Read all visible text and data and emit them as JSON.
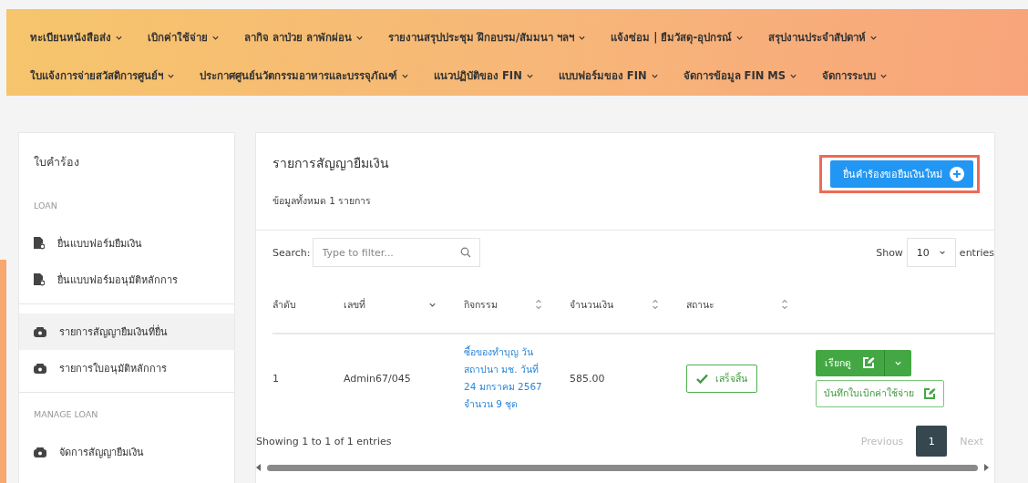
{
  "nav_rows": [
    [
      {
        "label": "ทะเบียนหนังสือส่ง"
      },
      {
        "label": "เบิกค่าใช้จ่าย"
      },
      {
        "label": "ลากิจ ลาป่วย ลาพักผ่อน"
      },
      {
        "label": "รายงานสรุปประชุม ฝึกอบรม/สัมมนา ฯลฯ"
      },
      {
        "label": "แจ้งซ่อม | ยืมวัสดุ-อุปกรณ์"
      },
      {
        "label": "สรุปงานประจำสัปดาห์"
      }
    ],
    [
      {
        "label": "ใบแจ้งการจ่ายสวัสดิการศูนย์ฯ"
      },
      {
        "label": "ประกาศศูนย์นวัตกรรมอาหารและบรรจุภัณฑ์"
      },
      {
        "label": "แนวปฏิบัติของ FIN"
      },
      {
        "label": "แบบฟอร์มของ FIN"
      },
      {
        "label": "จัดการข้อมูล FIN MS"
      },
      {
        "label": "จัดการระบบ"
      }
    ]
  ],
  "sidebar": {
    "title": "ใบคำร้อง",
    "sections": [
      {
        "heading": "LOAN",
        "items": [
          {
            "label": "ยื่นแบบฟอร์มยืมเงิน",
            "kind": "file",
            "selected": false
          },
          {
            "label": "ยื่นแบบฟอร์มอนุมัติหลักการ",
            "kind": "file",
            "selected": false
          }
        ]
      },
      {
        "items": [
          {
            "label": "รายการสัญญายืมเงินที่ยื่น",
            "kind": "cash",
            "selected": true
          },
          {
            "label": "รายการใบอนุมัติหลักการ",
            "kind": "cash",
            "selected": false
          }
        ]
      },
      {
        "heading": "MANAGE LOAN",
        "items": [
          {
            "label": "จัดการสัญญายืมเงิน",
            "kind": "cash",
            "selected": false
          }
        ]
      }
    ]
  },
  "main": {
    "title": "รายการสัญญายืมเงิน",
    "subtitle": "ข้อมูลทั้งหมด 1 รายการ",
    "new_button": {
      "label": "ยื่นคำร้องขอยืมเงินใหม่",
      "highlighted": true
    },
    "search": {
      "label": "Search:",
      "placeholder": "Type to filter..."
    },
    "page_size": {
      "before": "Show",
      "value": "10",
      "after": "entries"
    },
    "table": {
      "columns": [
        {
          "label": "ลำดับ",
          "kind": "plain"
        },
        {
          "label": "เลขที่",
          "kind": "sorted"
        },
        {
          "label": "กิจกรรม",
          "kind": "sortable"
        },
        {
          "label": "จำนวนเงิน",
          "kind": "sortable"
        },
        {
          "label": "สถานะ",
          "kind": "sortable"
        }
      ],
      "rows": [
        {
          "no": "1",
          "number": "Admin67/045",
          "activity": "ซื้อของทำบุญ วันสถาปนา มช. วันที่ 24 มกราคม 2567 จำนวน 9 ชุด",
          "amount": "585.00",
          "status": "เสร็จสิ้น",
          "view_button": "เรียกดู",
          "record_button": "บันทึกใบเบิกค่าใช้จ่าย"
        }
      ]
    },
    "info": "Showing 1 to 1 of 1 entries",
    "pagination": [
      {
        "label": "Previous",
        "disabled": true,
        "selected": false
      },
      {
        "label": "1",
        "disabled": false,
        "selected": true
      },
      {
        "label": "Next",
        "disabled": true,
        "selected": false
      }
    ]
  }
}
